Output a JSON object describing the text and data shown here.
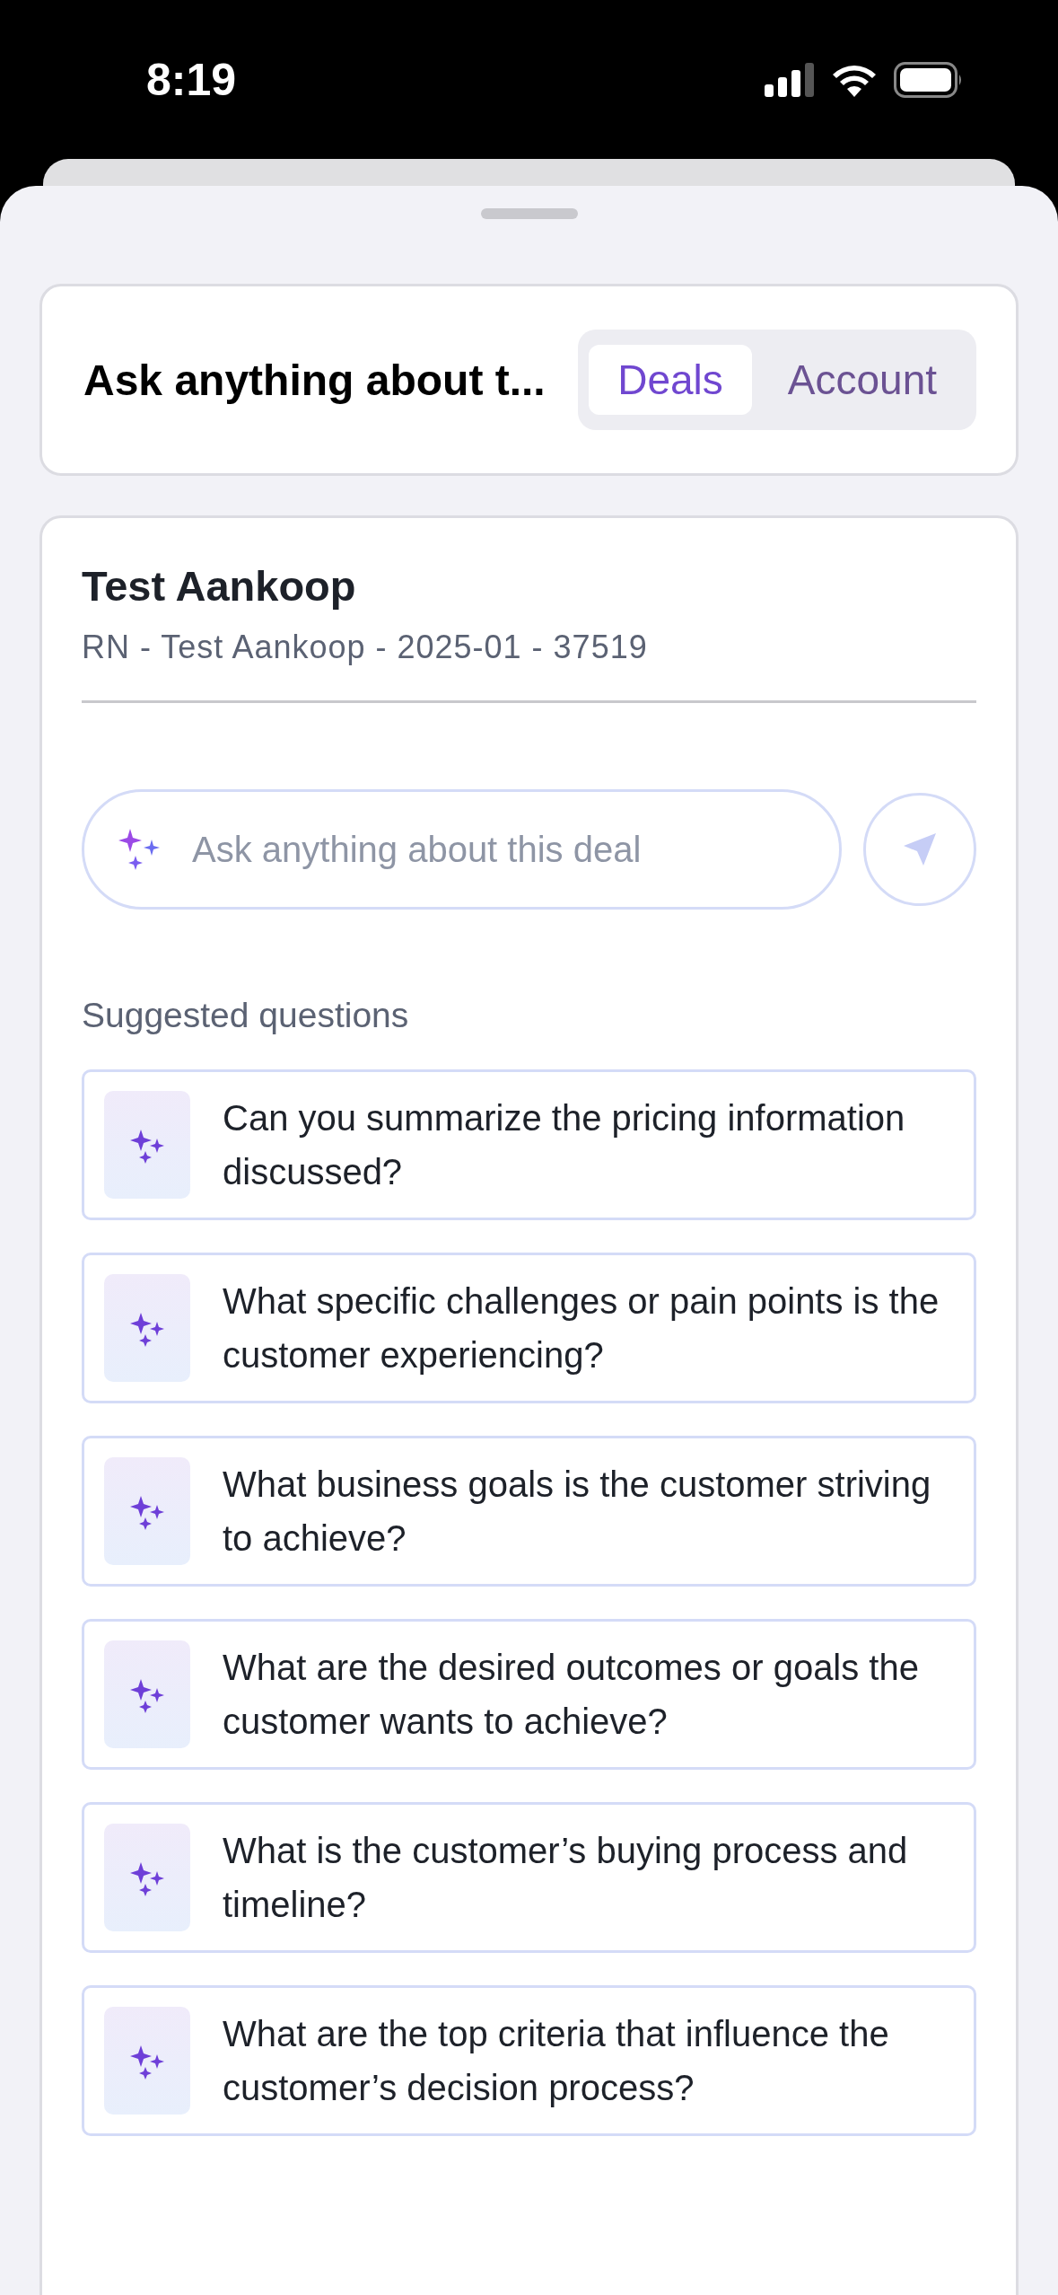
{
  "status_bar": {
    "time": "8:19"
  },
  "header": {
    "title": "Ask anything about t...",
    "tabs": [
      {
        "label": "Deals",
        "selected": true
      },
      {
        "label": "Account",
        "selected": false
      }
    ]
  },
  "deal": {
    "title": "Test Aankoop",
    "subtitle": "RN - Test Aankoop - 2025-01 - 37519"
  },
  "ask_field": {
    "placeholder": "Ask anything about this deal"
  },
  "suggested": {
    "heading": "Suggested questions",
    "questions": [
      "Can you summarize the pricing information discussed?",
      "What specific challenges or pain points is the customer experiencing?",
      "What business goals is the customer striving to achieve?",
      "What are the desired outcomes or goals the customer wants to achieve?",
      "What is the customer’s buying process and timeline?",
      "What are the top criteria that influence the customer’s decision process?"
    ]
  }
}
